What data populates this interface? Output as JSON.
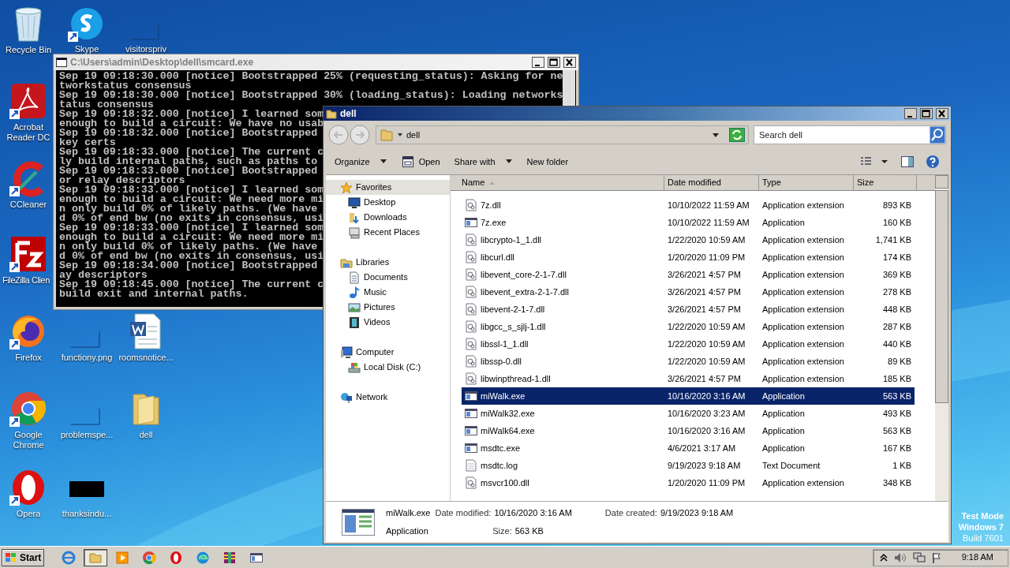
{
  "desktop_icons": [
    {
      "label": "Recycle Bin",
      "kind": "bin",
      "shortcut": false
    },
    {
      "label": "Skype",
      "kind": "skype",
      "shortcut": true
    },
    {
      "label": "visitorspriv",
      "kind": "blank",
      "shortcut": false
    },
    {
      "label": "Acrobat Reader DC",
      "kind": "acrobat",
      "shortcut": true
    },
    {
      "label": "CCleaner",
      "kind": "ccleaner",
      "shortcut": true
    },
    {
      "label": "FileZilla Clien",
      "kind": "filezilla",
      "shortcut": true
    },
    {
      "label": "Firefox",
      "kind": "firefox",
      "shortcut": true
    },
    {
      "label": "functiony.png",
      "kind": "blank",
      "shortcut": false
    },
    {
      "label": "roomsnotice...",
      "kind": "word",
      "shortcut": false
    },
    {
      "label": "Google Chrome",
      "kind": "chrome",
      "shortcut": true
    },
    {
      "label": "problemspe...",
      "kind": "blank",
      "shortcut": false
    },
    {
      "label": "dell",
      "kind": "folder",
      "shortcut": false
    },
    {
      "label": "Opera",
      "kind": "opera",
      "shortcut": true
    },
    {
      "label": "thanksindu...",
      "kind": "black",
      "shortcut": false
    }
  ],
  "test_mode": [
    "Test Mode",
    "Windows 7",
    "Build 7601"
  ],
  "console": {
    "title": "C:\\Users\\admin\\Desktop\\dell\\smcard.exe",
    "lines": [
      "Sep 19 09:18:30.000 [notice] Bootstrapped 25% (requesting_status): Asking for ne",
      "tworkstatus consensus",
      "Sep 19 09:18:30.000 [notice] Bootstrapped 30% (loading_status): Loading networks",
      "tatus consensus",
      "Sep 19 09:18:32.000 [notice] I learned som",
      "enough to build a circuit: We have no usab",
      "Sep 19 09:18:32.000 [notice] Bootstrapped",
      "key certs",
      "Sep 19 09:18:33.000 [notice] The current c",
      "ly build internal paths, such as paths to",
      "Sep 19 09:18:33.000 [notice] Bootstrapped",
      "or relay descriptors",
      "Sep 19 09:18:33.000 [notice] I learned som",
      "enough to build a circuit: We need more mi",
      "n only build 0% of likely paths. (We have",
      "d 0% of end bw (no exits in consensus, usi",
      "Sep 19 09:18:33.000 [notice] I learned som",
      "enough to build a circuit: We need more mi",
      "n only build 0% of likely paths. (We have",
      "d 0% of end bw (no exits in consensus, usi",
      "Sep 19 09:18:34.000 [notice] Bootstrapped",
      "ay descriptors",
      "Sep 19 09:18:45.000 [notice] The current c",
      "build exit and internal paths."
    ]
  },
  "explorer": {
    "title": "dell",
    "address": "dell",
    "search_placeholder": "Search dell",
    "toolbar": [
      {
        "label": "Organize",
        "kind": "menu"
      },
      {
        "label": "Open",
        "kind": "open"
      },
      {
        "label": "Share with",
        "kind": "menu"
      },
      {
        "label": "New folder",
        "kind": "plain"
      }
    ],
    "nav": [
      {
        "label": "Favorites",
        "kind": "star",
        "selected": true,
        "children": [
          {
            "label": "Desktop",
            "kind": "desktop",
            "selected": false
          },
          {
            "label": "Downloads",
            "kind": "downloads",
            "selected": false
          },
          {
            "label": "Recent Places",
            "kind": "recent",
            "selected": false
          }
        ]
      },
      {
        "label": "Libraries",
        "kind": "libraries",
        "selected": false,
        "children": [
          {
            "label": "Documents",
            "kind": "documents",
            "selected": false
          },
          {
            "label": "Music",
            "kind": "music",
            "selected": false
          },
          {
            "label": "Pictures",
            "kind": "pictures",
            "selected": false
          },
          {
            "label": "Videos",
            "kind": "videos",
            "selected": false
          }
        ]
      },
      {
        "label": "Computer",
        "kind": "computer",
        "selected": false,
        "children": [
          {
            "label": "Local Disk (C:)",
            "kind": "disk",
            "selected": false
          }
        ]
      },
      {
        "label": "Network",
        "kind": "network",
        "selected": false
      }
    ],
    "columns": [
      "Name",
      "Date modified",
      "Type",
      "Size"
    ],
    "files": [
      {
        "name": "7z.dll",
        "date": "10/10/2022 11:59 AM",
        "type": "Application extension",
        "size": "893 KB",
        "kind": "dll",
        "selected": false
      },
      {
        "name": "7z.exe",
        "date": "10/10/2022 11:59 AM",
        "type": "Application",
        "size": "160 KB",
        "kind": "exe",
        "selected": false
      },
      {
        "name": "libcrypto-1_1.dll",
        "date": "1/22/2020 10:59 AM",
        "type": "Application extension",
        "size": "1,741 KB",
        "kind": "dll",
        "selected": false
      },
      {
        "name": "libcurl.dll",
        "date": "1/20/2020 11:09 PM",
        "type": "Application extension",
        "size": "174 KB",
        "kind": "dll",
        "selected": false
      },
      {
        "name": "libevent_core-2-1-7.dll",
        "date": "3/26/2021 4:57 PM",
        "type": "Application extension",
        "size": "369 KB",
        "kind": "dll",
        "selected": false
      },
      {
        "name": "libevent_extra-2-1-7.dll",
        "date": "3/26/2021 4:57 PM",
        "type": "Application extension",
        "size": "278 KB",
        "kind": "dll",
        "selected": false
      },
      {
        "name": "libevent-2-1-7.dll",
        "date": "3/26/2021 4:57 PM",
        "type": "Application extension",
        "size": "448 KB",
        "kind": "dll",
        "selected": false
      },
      {
        "name": "libgcc_s_sjlj-1.dll",
        "date": "1/22/2020 10:59 AM",
        "type": "Application extension",
        "size": "287 KB",
        "kind": "dll",
        "selected": false
      },
      {
        "name": "libssl-1_1.dll",
        "date": "1/22/2020 10:59 AM",
        "type": "Application extension",
        "size": "440 KB",
        "kind": "dll",
        "selected": false
      },
      {
        "name": "libssp-0.dll",
        "date": "1/22/2020 10:59 AM",
        "type": "Application extension",
        "size": "89 KB",
        "kind": "dll",
        "selected": false
      },
      {
        "name": "libwinpthread-1.dll",
        "date": "3/26/2021 4:57 PM",
        "type": "Application extension",
        "size": "185 KB",
        "kind": "dll",
        "selected": false
      },
      {
        "name": "miWalk.exe",
        "date": "10/16/2020 3:16 AM",
        "type": "Application",
        "size": "563 KB",
        "kind": "exe",
        "selected": true
      },
      {
        "name": "miWalk32.exe",
        "date": "10/16/2020 3:23 AM",
        "type": "Application",
        "size": "493 KB",
        "kind": "exe",
        "selected": false
      },
      {
        "name": "miWalk64.exe",
        "date": "10/16/2020 3:16 AM",
        "type": "Application",
        "size": "563 KB",
        "kind": "exe",
        "selected": false
      },
      {
        "name": "msdtc.exe",
        "date": "4/6/2021 3:17 AM",
        "type": "Application",
        "size": "167 KB",
        "kind": "exe",
        "selected": false
      },
      {
        "name": "msdtc.log",
        "date": "9/19/2023 9:18 AM",
        "type": "Text Document",
        "size": "1 KB",
        "kind": "txt",
        "selected": false
      },
      {
        "name": "msvcr100.dll",
        "date": "1/20/2020 11:09 PM",
        "type": "Application extension",
        "size": "348 KB",
        "kind": "dll",
        "selected": false
      }
    ],
    "details": {
      "name": "miWalk.exe",
      "type": "Application",
      "fields": [
        {
          "label": "Date modified:",
          "value": "10/16/2020 3:16 AM"
        },
        {
          "label": "Size:",
          "value": "563 KB"
        },
        {
          "label": "Date created:",
          "value": "9/19/2023 9:18 AM"
        }
      ]
    }
  },
  "taskbar": {
    "start": "Start",
    "apps": [
      {
        "kind": "ie",
        "selected": false
      },
      {
        "kind": "explorer",
        "selected": true
      },
      {
        "kind": "media",
        "selected": false
      },
      {
        "kind": "chrome",
        "selected": false
      },
      {
        "kind": "opera",
        "selected": false
      },
      {
        "kind": "edge",
        "selected": false
      },
      {
        "kind": "winrar",
        "selected": false
      },
      {
        "kind": "window",
        "selected": false
      }
    ],
    "clock": "9:18 AM"
  }
}
